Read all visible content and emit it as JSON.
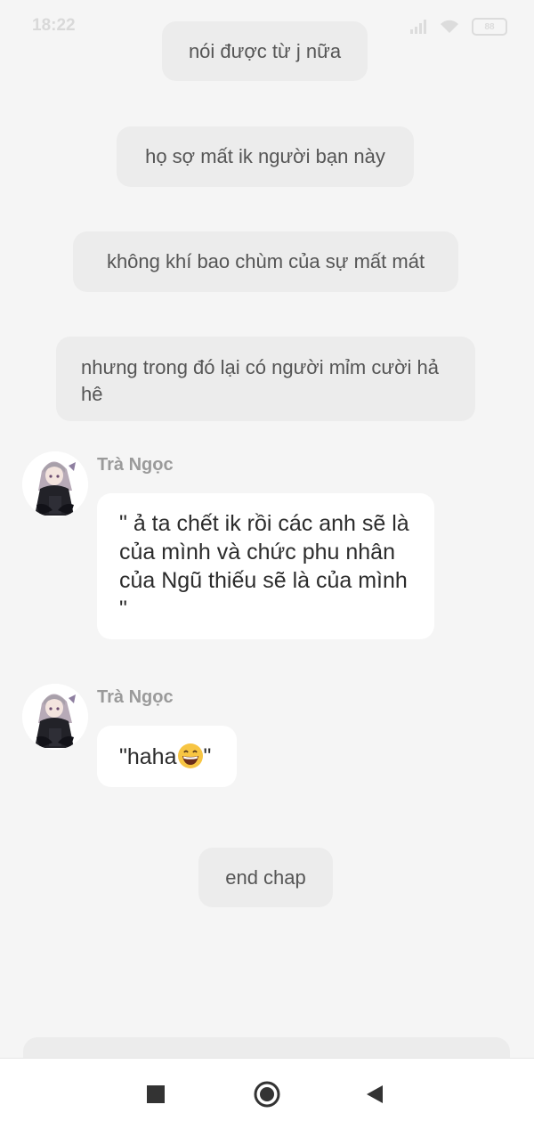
{
  "status_bar": {
    "time": "18:22",
    "battery": "88"
  },
  "narration": [
    "nói được từ j nữa",
    "họ sợ mất ik người bạn này",
    "không khí bao chùm của sự mất mát",
    "nhưng trong đó lại có người mỉm cười hả hê",
    "end chap"
  ],
  "messages": [
    {
      "sender": "Trà Ngọc",
      "text": "\" ả ta chết ik rồi các anh sẽ là của mình và chức phu nhân của Ngũ thiếu sẽ là của mình \""
    },
    {
      "sender": "Trà Ngọc",
      "text_before": "\"haha",
      "text_after": "\"",
      "emoji": "grinning-face-emoji"
    }
  ],
  "nav": {
    "recent_icon": "square-icon",
    "home_icon": "circle-icon",
    "back_icon": "triangle-back-icon"
  },
  "colors": {
    "background": "#f5f5f5",
    "narration_bubble": "#ececec",
    "message_bubble": "#ffffff",
    "sender_name": "#9a9a9a"
  }
}
